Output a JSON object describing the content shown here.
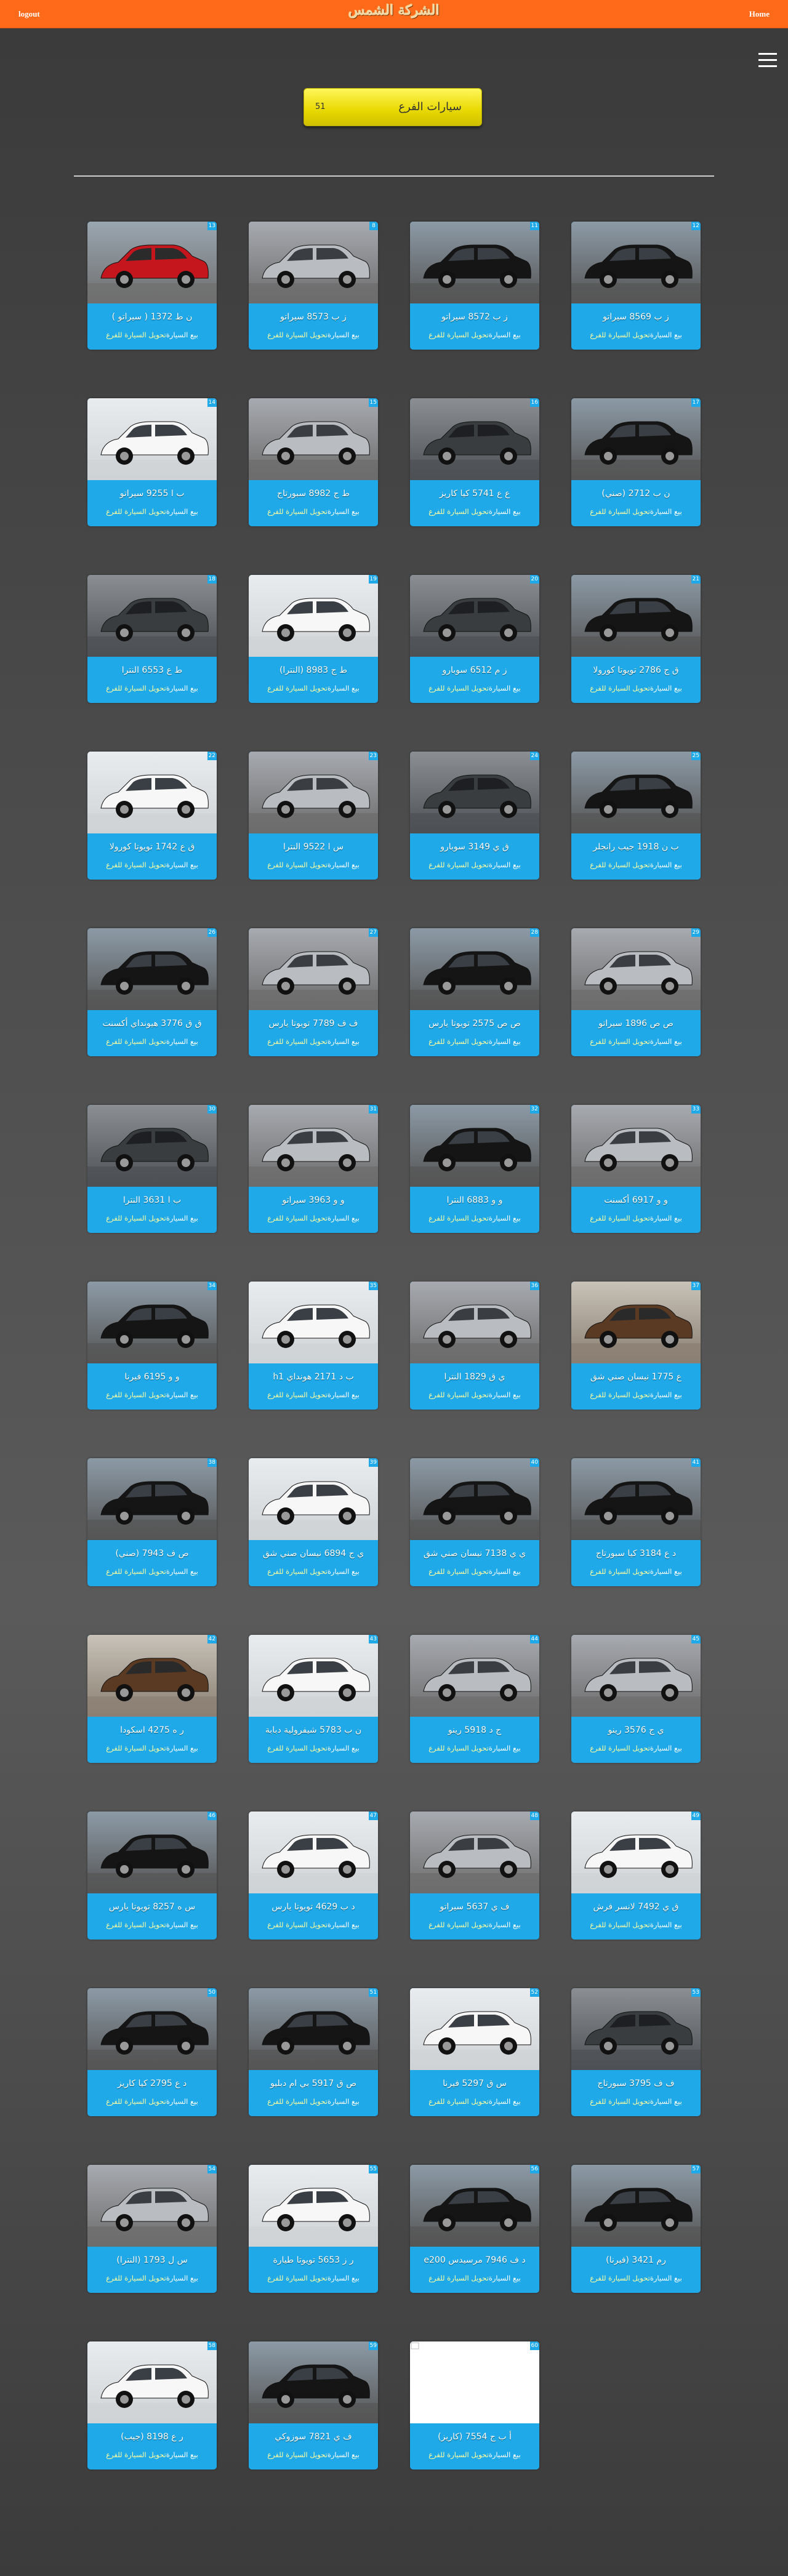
{
  "header": {
    "logout_label": "logout",
    "home_label": "Home",
    "logo_text": "الشركة الشمس"
  },
  "menu_icon": "hamburger-menu-icon",
  "branch_button": {
    "label": "سيارات الفرع",
    "count": "51"
  },
  "card_actions": {
    "sell": "بيع السيارة",
    "transfer": "تحويل السيارة للفرع"
  },
  "colors": {
    "topbar": "#ff6a1a",
    "card": "#1fa9e8",
    "button": "#e8d800"
  },
  "cars": [
    {
      "num": "13",
      "title": "ن ط 1372 ( سيراتو )",
      "style": "red"
    },
    {
      "num": "8",
      "title": "ز ب 8573 سيراتو",
      "style": "silver"
    },
    {
      "num": "11",
      "title": "ز ب 8572 سيراتو",
      "style": "black"
    },
    {
      "num": "12",
      "title": "ز ب 8569 سيراتو",
      "style": "black"
    },
    {
      "num": "14",
      "title": "ب ا 9255 سيراتو",
      "style": "white"
    },
    {
      "num": "15",
      "title": "ط ج 8982 سبورتاج",
      "style": "silver"
    },
    {
      "num": "16",
      "title": "ع ع 5741 كيا كاريز",
      "style": "dark"
    },
    {
      "num": "17",
      "title": "ن ب 2712 (صني)",
      "style": "black"
    },
    {
      "num": "18",
      "title": "ط ع 6553 النترا",
      "style": "dark"
    },
    {
      "num": "19",
      "title": "ط ج 8983 (النترا)",
      "style": "white"
    },
    {
      "num": "20",
      "title": "ز م 6512 سوبارو",
      "style": "dark"
    },
    {
      "num": "21",
      "title": "ق ج 2786 تويوتا كورولا",
      "style": "black"
    },
    {
      "num": "22",
      "title": "ق ع 1742 تويوتا كورولا",
      "style": "white"
    },
    {
      "num": "23",
      "title": "س ا 9522 النترا",
      "style": "silver"
    },
    {
      "num": "24",
      "title": "ق ي 3149 سوبارو",
      "style": "dark"
    },
    {
      "num": "25",
      "title": "ب ن 1918 جيب رانجلر",
      "style": "black"
    },
    {
      "num": "26",
      "title": "ق ق 3776 هيونداي أكسنت",
      "style": "black"
    },
    {
      "num": "27",
      "title": "ف ف 7789 تويوتا يارس",
      "style": "silver"
    },
    {
      "num": "28",
      "title": "ص ص 2575 تويوتا يارس",
      "style": "black"
    },
    {
      "num": "29",
      "title": "ص ص 1896 سيراتو",
      "style": "silver"
    },
    {
      "num": "30",
      "title": "ب ا 3631 النترا",
      "style": "dark"
    },
    {
      "num": "31",
      "title": "و و 3963 سيراتو",
      "style": "silver"
    },
    {
      "num": "32",
      "title": "و و 6883 النترا",
      "style": "black"
    },
    {
      "num": "33",
      "title": "و و 6917 أكسنت",
      "style": "silver"
    },
    {
      "num": "34",
      "title": "و و 6195 فيرنا",
      "style": "black"
    },
    {
      "num": "35",
      "title": "ب د 2171 هونداي h1",
      "style": "white"
    },
    {
      "num": "36",
      "title": "ي ق 1829 النترا",
      "style": "silver"
    },
    {
      "num": "37",
      "title": "ع 1775 نيسان صني شق",
      "style": "brown"
    },
    {
      "num": "38",
      "title": "ص ف 7943 (صني)",
      "style": "black"
    },
    {
      "num": "39",
      "title": "ي ج 6894 نيسان صني شق",
      "style": "white"
    },
    {
      "num": "40",
      "title": "ي ي 7138 نيسان صني شق",
      "style": "black"
    },
    {
      "num": "41",
      "title": "د ع 3184 كيا سبورتاج",
      "style": "black"
    },
    {
      "num": "42",
      "title": "ر ه 4275 اسكودا",
      "style": "brown"
    },
    {
      "num": "43",
      "title": "ن ب 5783 شيفرولية دبابة",
      "style": "white"
    },
    {
      "num": "44",
      "title": "ج د 5918 رينو",
      "style": "silver"
    },
    {
      "num": "45",
      "title": "ي ج 3576 رينو",
      "style": "silver"
    },
    {
      "num": "46",
      "title": "س ه 8257 تويوتا يارس",
      "style": "black"
    },
    {
      "num": "47",
      "title": "د ب 4629 تويوتا يارس",
      "style": "white"
    },
    {
      "num": "48",
      "title": "ف ي 5637 سيراتو",
      "style": "silver"
    },
    {
      "num": "49",
      "title": "ق ي 7492 لانسر فرش",
      "style": "white"
    },
    {
      "num": "50",
      "title": "د ع 2795 كيا كاريز",
      "style": "black"
    },
    {
      "num": "51",
      "title": "ص ق 5917 بي ام دبليو",
      "style": "black"
    },
    {
      "num": "52",
      "title": "س ق 5297 فيرنا",
      "style": "white"
    },
    {
      "num": "53",
      "title": "ف ف 3795 سبورتاج",
      "style": "dark"
    },
    {
      "num": "54",
      "title": "س ل 1793 (النترا)",
      "style": "silver"
    },
    {
      "num": "55",
      "title": "ر ز 5653 تويوتا طيارة",
      "style": "white"
    },
    {
      "num": "56",
      "title": "د ف 7946 مرسيدس e200",
      "style": "black"
    },
    {
      "num": "57",
      "title": "رم 3421 (فيرنا)",
      "style": "black"
    },
    {
      "num": "58",
      "title": "ر ع 8198 (جيب)",
      "style": "white"
    },
    {
      "num": "59",
      "title": "ف ي 7821 سوزوكي",
      "style": "black"
    },
    {
      "num": "60",
      "title": "أ ب ج 7554 (كاريز)",
      "style": "blank"
    }
  ]
}
